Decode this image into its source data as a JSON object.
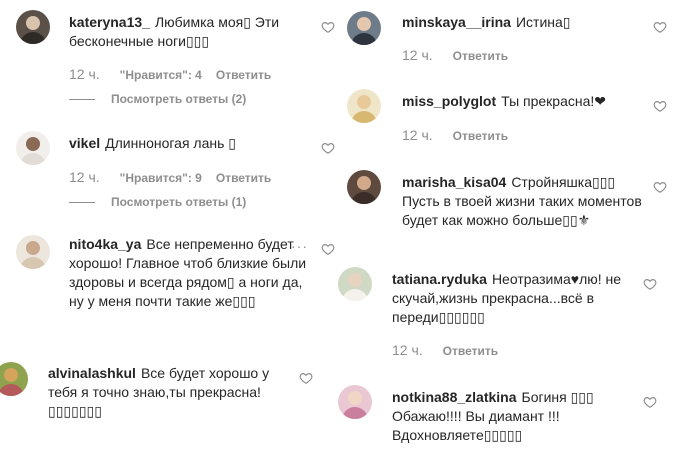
{
  "left_column": [
    {
      "username": "kateryna13_",
      "text": "Любимка моя▯ Эти бесконечные ноги▯▯▯",
      "time": "12 ч.",
      "likes": "\"Нравится\": 4",
      "reply": "Ответить",
      "view_replies": "Посмотреть ответы (2)"
    },
    {
      "username": "vikel",
      "text": "Длинноногая лань ▯",
      "time": "12 ч.",
      "likes": "\"Нравится\": 9",
      "reply": "Ответить",
      "view_replies": "Посмотреть ответы (1)"
    },
    {
      "username": "nito4ka_ya",
      "text": "Все непременно будет хорошо! Главное чтоб близкие были здоровы и всегда рядом▯ а ноги да, ну у меня почти такие же▯▯▯",
      "more": "···"
    },
    {
      "username": "alvinalashkul",
      "text": "Все будет хорошо у тебя я точно знаю,ты прекрасна! ▯▯▯▯▯▯▯"
    }
  ],
  "right_column": [
    {
      "username": "minskaya__irina",
      "text": "Истина▯",
      "time": "12 ч.",
      "reply": "Ответить"
    },
    {
      "username": "miss_polyglot",
      "text": "Ты прекрасна!❤",
      "time": "12 ч.",
      "reply": "Ответить"
    },
    {
      "username": "marisha_kisa04",
      "text": "Стройняшка▯▯▯ Пусть в твоей жизни таких моментов будет как можно больше▯▯⚜"
    },
    {
      "username": "tatiana.ryduka",
      "text": "Неотразима♥лю! не скучай,жизнь прекрасна...всё в переди▯▯▯▯▯▯",
      "time": "12 ч.",
      "reply": "Ответить"
    },
    {
      "username": "notkina88_zlatkina",
      "text": "Богиня ▯▯▯ Обажаю!!!! Вы диамант !!! Вдохновляете▯▯▯▯▯"
    }
  ],
  "colors": {
    "text": "#262626",
    "secondary": "#8e8e8e",
    "background": "#ffffff"
  },
  "icons": {
    "like": "heart-outline-icon",
    "more": "more-options-icon"
  }
}
